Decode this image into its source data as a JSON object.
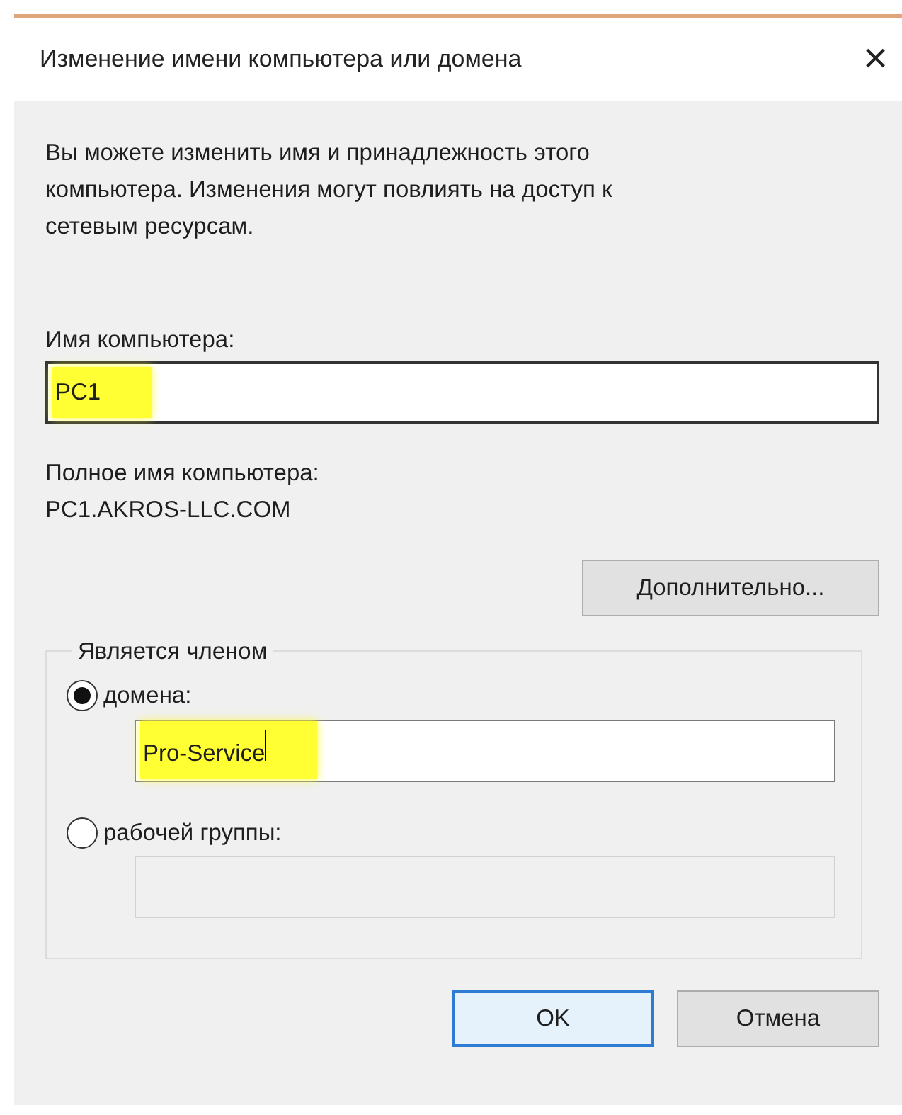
{
  "window": {
    "title": "Изменение имени компьютера или домена",
    "close": "×"
  },
  "description": "Вы можете изменить имя и принадлежность этого компьютера. Изменения могут повлиять на доступ к сетевым ресурсам.",
  "computer_name": {
    "label": "Имя компьютера:",
    "value": "PC1",
    "highlighted": true
  },
  "full_name": {
    "label": "Полное имя компьютера:",
    "value": "PC1.AKROS-LLC.COM"
  },
  "more_button": "Дополнительно...",
  "member_of": {
    "legend": "Является членом",
    "options": [
      {
        "label": "домена:",
        "selected": true,
        "value": "Pro-Service",
        "highlighted": true,
        "focused": true,
        "disabled": false
      },
      {
        "label": "рабочей группы:",
        "selected": false,
        "highlighted": false,
        "focused": false,
        "disabled": true
      }
    ]
  },
  "buttons": [
    {
      "label": "OK",
      "default": true
    },
    {
      "label": "Отмена",
      "default": false
    }
  ]
}
